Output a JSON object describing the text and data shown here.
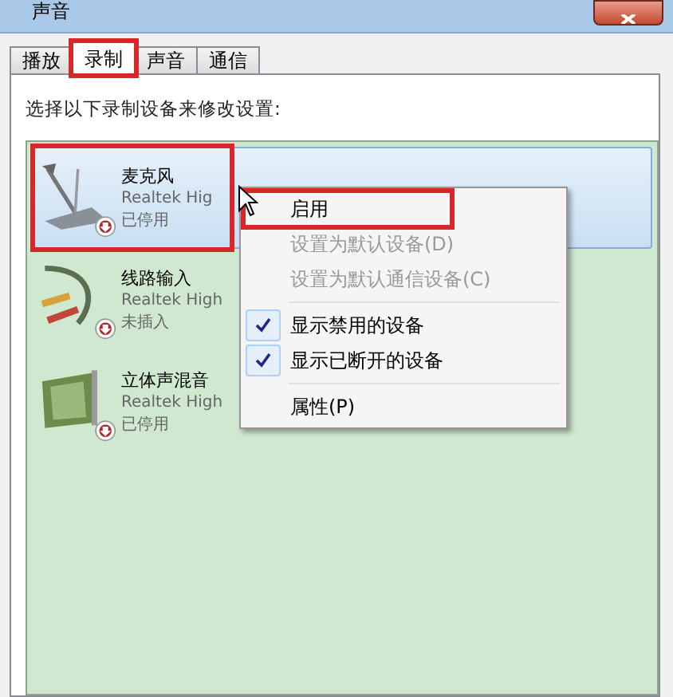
{
  "window": {
    "title": "声音"
  },
  "tabs": [
    {
      "label": "播放",
      "selected": false,
      "highlighted": false
    },
    {
      "label": "录制",
      "selected": true,
      "highlighted": true
    },
    {
      "label": "声音",
      "selected": false,
      "highlighted": false
    },
    {
      "label": "通信",
      "selected": false,
      "highlighted": false
    }
  ],
  "instruction": "选择以下录制设备来修改设置:",
  "devices": [
    {
      "kind": "microphone",
      "name": "麦克风",
      "driver": "Realtek Hig",
      "status": "已停用",
      "selected": true,
      "highlighted": true
    },
    {
      "kind": "cable",
      "name": "线路输入",
      "driver": "Realtek High",
      "status": "未插入",
      "selected": false,
      "highlighted": false
    },
    {
      "kind": "card",
      "name": "立体声混音",
      "driver": "Realtek High",
      "status": "已停用",
      "selected": false,
      "highlighted": false
    }
  ],
  "context_menu": {
    "groups": [
      [
        {
          "label": "启用",
          "disabled": false,
          "checked": false,
          "highlighted": true
        },
        {
          "label": "设置为默认设备(D)",
          "disabled": true,
          "checked": false,
          "highlighted": false
        },
        {
          "label": "设置为默认通信设备(C)",
          "disabled": true,
          "checked": false,
          "highlighted": false
        }
      ],
      [
        {
          "label": "显示禁用的设备",
          "disabled": false,
          "checked": true,
          "highlighted": false
        },
        {
          "label": "显示已断开的设备",
          "disabled": false,
          "checked": true,
          "highlighted": false
        }
      ],
      [
        {
          "label": "属性(P)",
          "disabled": false,
          "checked": false,
          "highlighted": false
        }
      ]
    ]
  }
}
